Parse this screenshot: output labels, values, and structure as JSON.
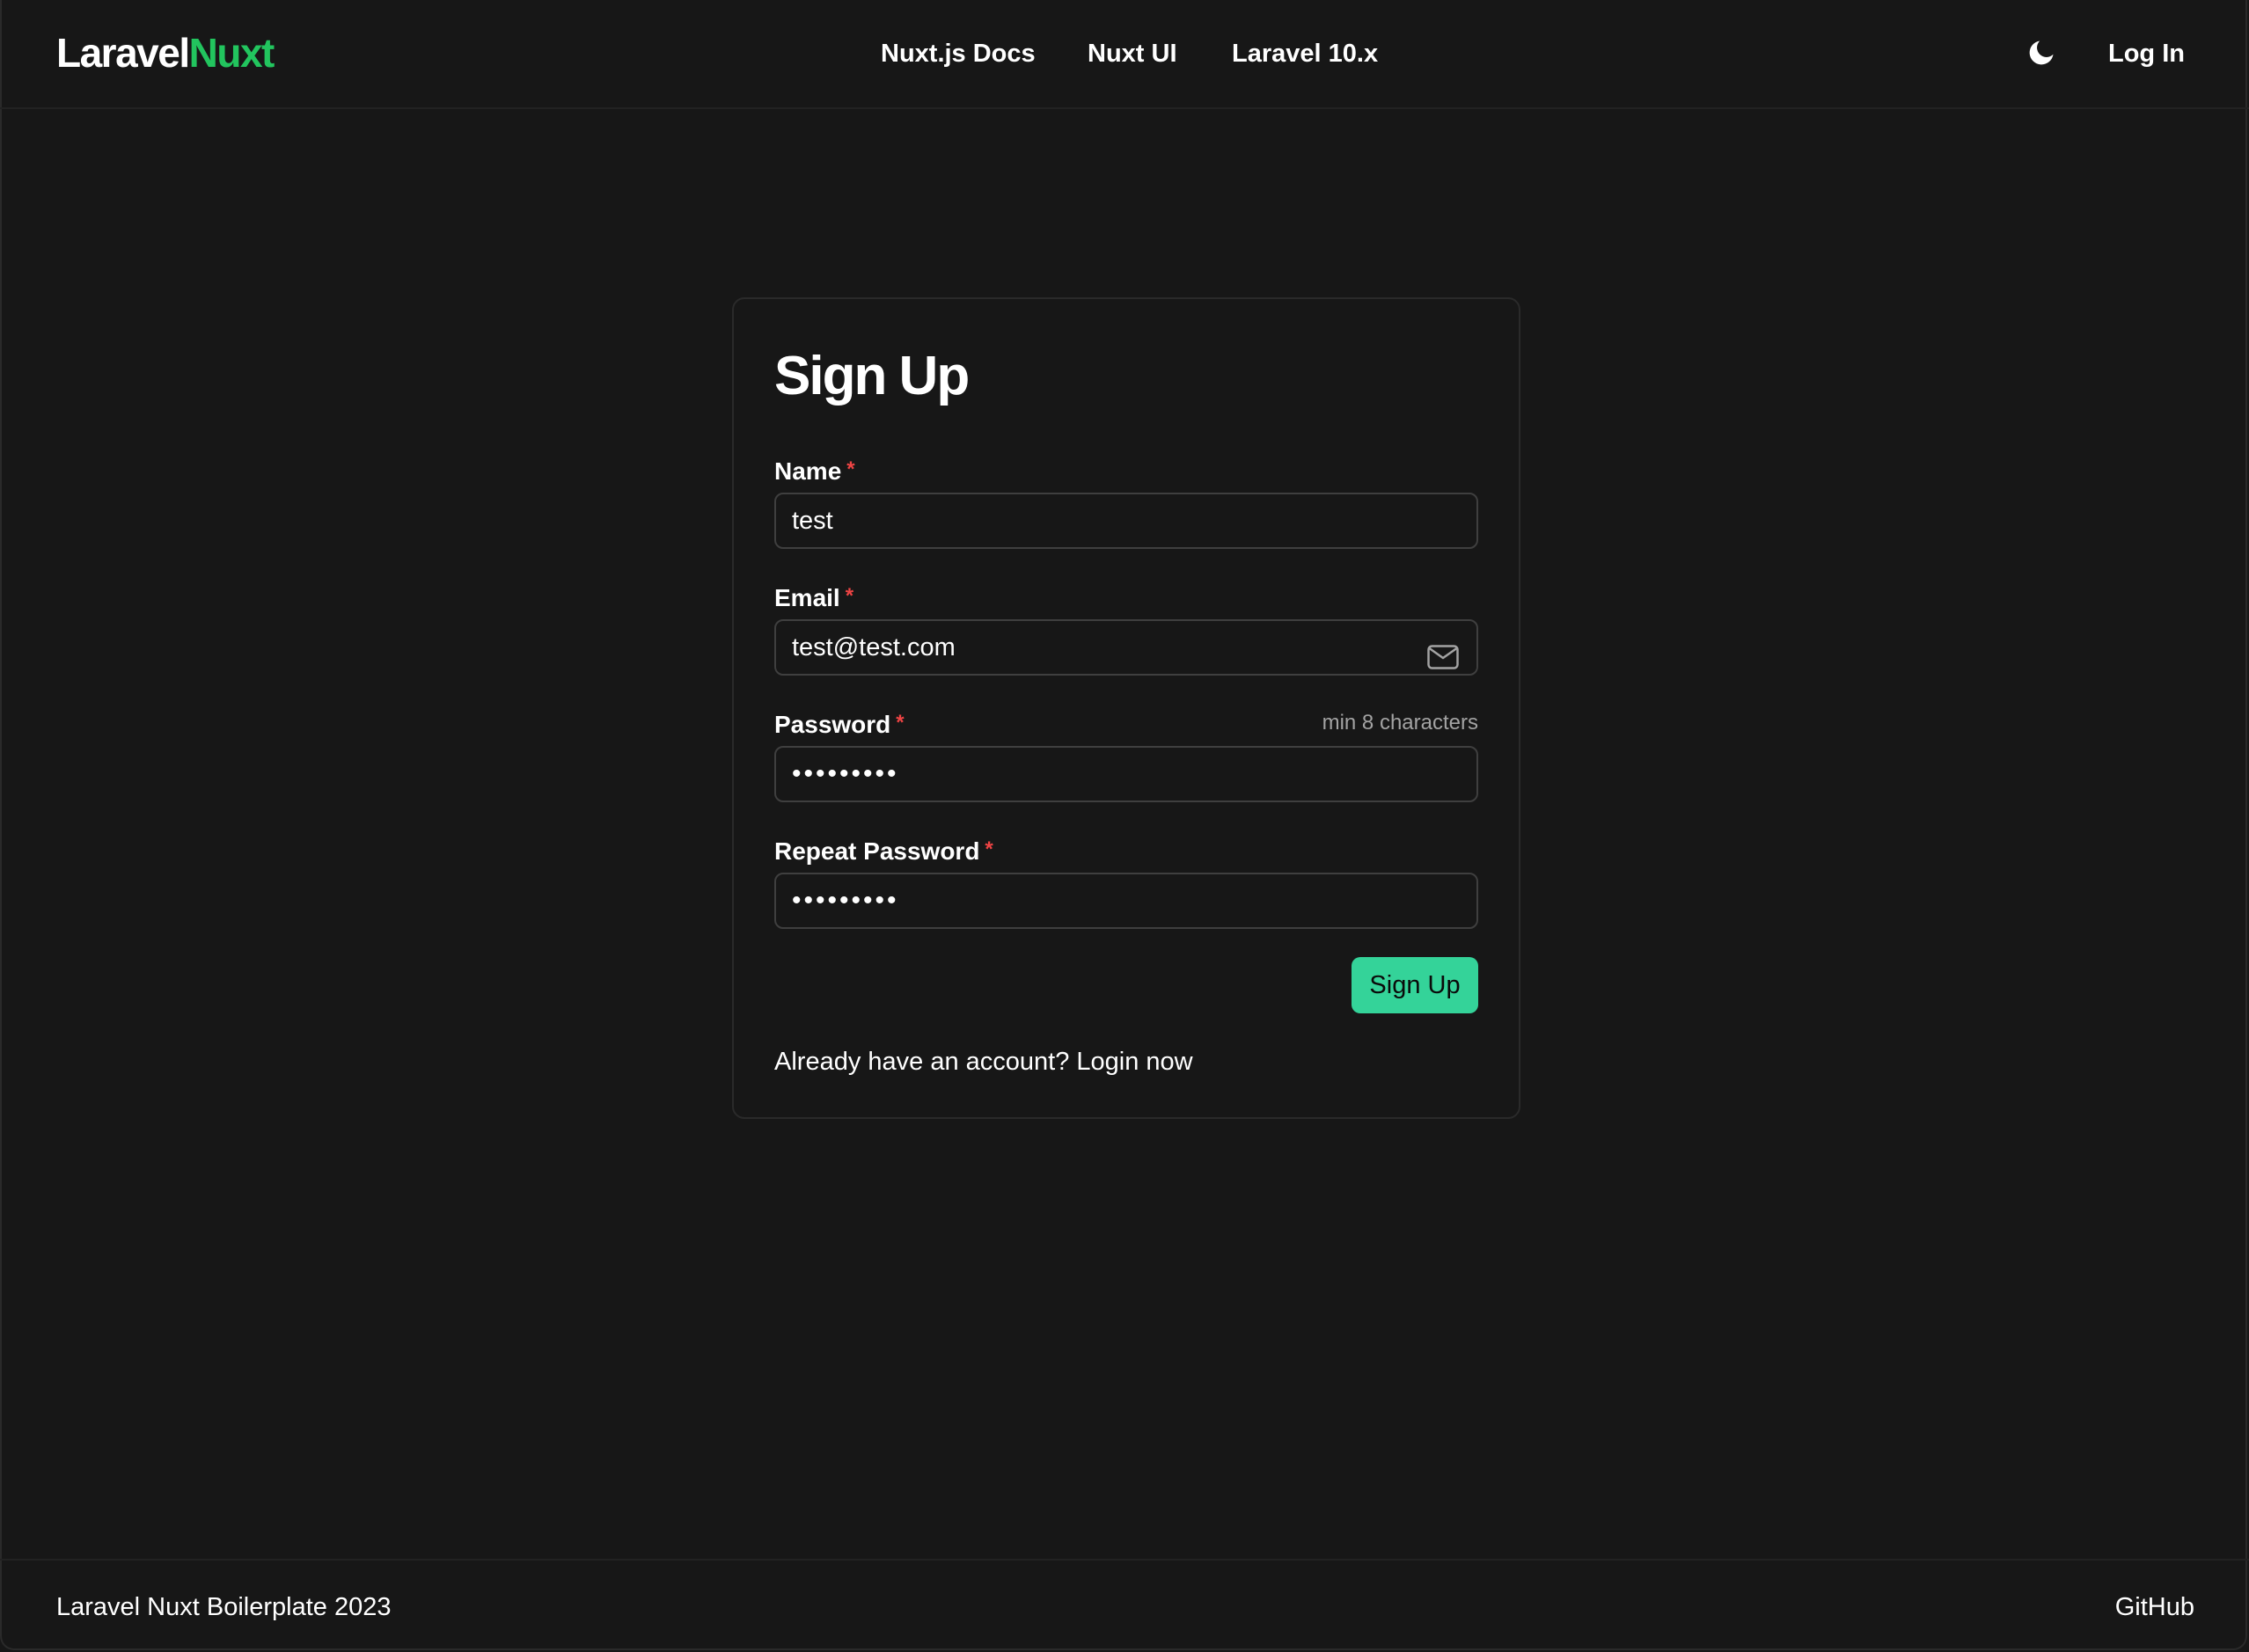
{
  "header": {
    "logo_part1": "Laravel",
    "logo_part2": "Nuxt",
    "nav": [
      {
        "label": "Nuxt.js Docs"
      },
      {
        "label": "Nuxt UI"
      },
      {
        "label": "Laravel 10.x"
      }
    ],
    "theme_toggle_icon": "moon-icon",
    "login_label": "Log In"
  },
  "form": {
    "title": "Sign Up",
    "required_mark": "*",
    "name": {
      "label": "Name",
      "value": "test"
    },
    "email": {
      "label": "Email",
      "value": "test@test.com",
      "icon": "envelope-icon"
    },
    "password": {
      "label": "Password",
      "hint": "min 8 characters",
      "value": "•••••••••"
    },
    "repeat_password": {
      "label": "Repeat Password",
      "value": "•••••••••"
    },
    "submit_label": "Sign Up",
    "login_prompt": "Already have an account? Login now"
  },
  "footer": {
    "copyright": "Laravel Nuxt Boilerplate 2023",
    "github_label": "GitHub"
  },
  "colors": {
    "background": "#171717",
    "accent": "#22c55e",
    "button": "#34d399",
    "required": "#ef4444",
    "hint": "#a3a3a3"
  }
}
